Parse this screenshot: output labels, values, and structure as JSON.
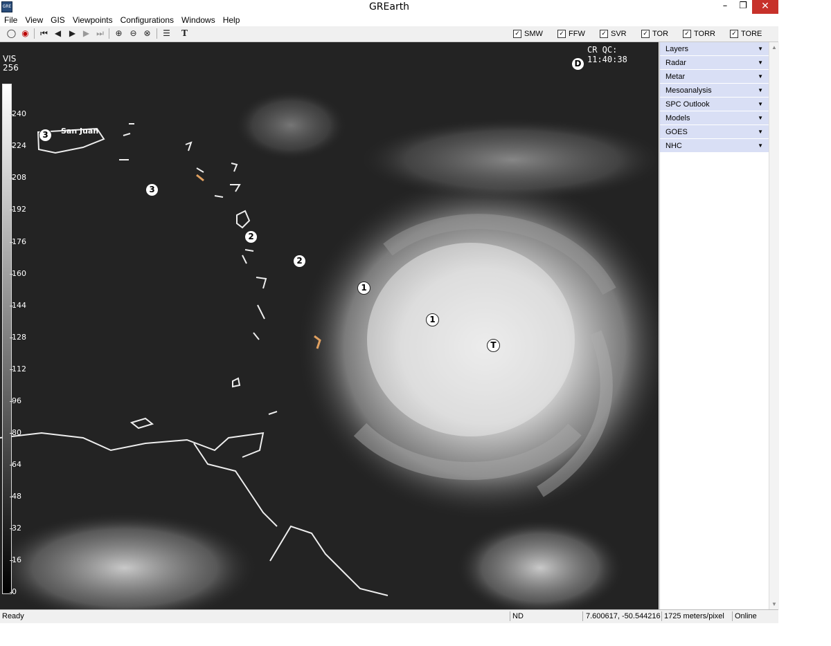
{
  "window": {
    "title": "GREarth",
    "icon_text": "GRE"
  },
  "menu": [
    "File",
    "View",
    "GIS",
    "Viewpoints",
    "Configurations",
    "Windows",
    "Help"
  ],
  "warning_filters": [
    {
      "label": "SMW",
      "checked": true
    },
    {
      "label": "FFW",
      "checked": true
    },
    {
      "label": "SVR",
      "checked": true
    },
    {
      "label": "TOR",
      "checked": true
    },
    {
      "label": "TORR",
      "checked": true
    },
    {
      "label": "TORE",
      "checked": true
    }
  ],
  "map": {
    "product_label": "VIS\n256",
    "clock": "CR QC: 11:40:38",
    "city": "San Juan",
    "scale_ticks": [
      "240",
      "224",
      "208",
      "192",
      "176",
      "160",
      "144",
      "128",
      "112",
      "96",
      "80",
      "64",
      "48",
      "32",
      "16",
      "0"
    ],
    "markers": [
      "3",
      "3",
      "2",
      "2",
      "1",
      "1",
      "T",
      "D"
    ]
  },
  "panel": [
    "Layers",
    "Radar",
    "Metar",
    "Mesoanalysis",
    "SPC Outlook",
    "Models",
    "GOES",
    "NHC"
  ],
  "status": {
    "ready": "Ready",
    "mode": "ND",
    "coords": "7.600617, -50.544216",
    "resolution": "1725 meters/pixel",
    "connection": "Online"
  }
}
